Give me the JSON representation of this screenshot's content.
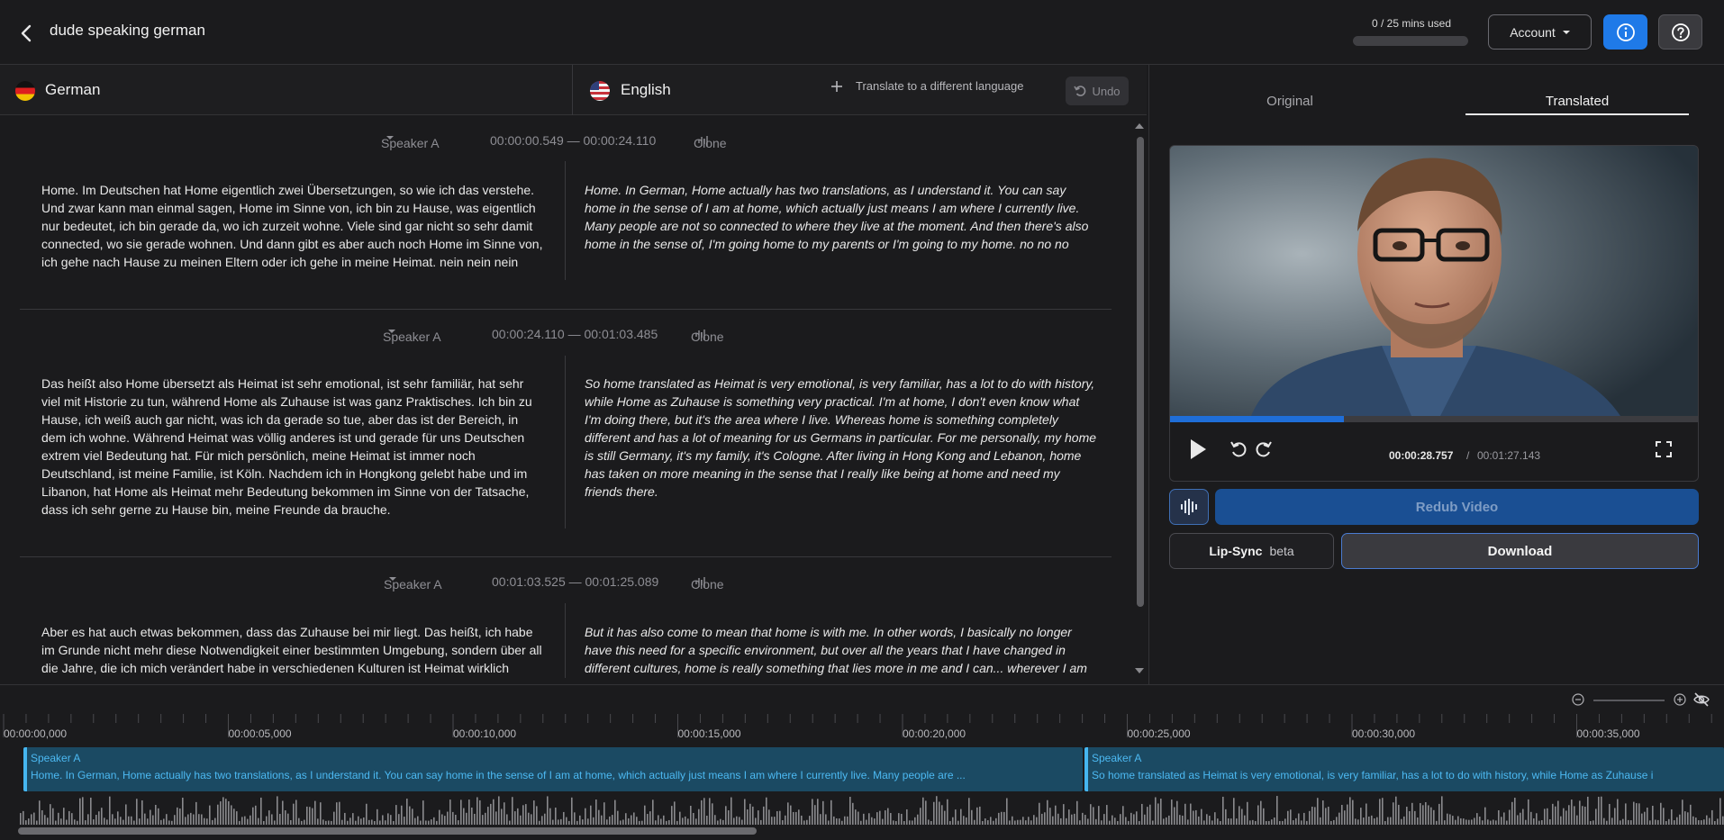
{
  "header": {
    "title": "dude speaking german",
    "usage_text": "0 / 25 mins used",
    "usage_fraction": 0,
    "account_label": "Account",
    "accent_color": "#1f7ae8"
  },
  "languages": {
    "source": "German",
    "target": "English",
    "translate_link": "Translate to a different language",
    "undo_label": "Undo"
  },
  "segments": [
    {
      "speaker": "Speaker A",
      "time_range": "00:00:00.549 — 00:00:24.110",
      "clone_label": "Clone",
      "original": "Home. Im Deutschen hat Home eigentlich zwei Übersetzungen, so wie ich das verstehe. Und zwar kann man einmal sagen, Home im Sinne von, ich bin zu Hause, was eigentlich nur bedeutet, ich bin gerade da, wo ich zurzeit wohne. Viele sind gar nicht so sehr damit connected, wo sie gerade wohnen. Und dann gibt es aber auch noch Home im Sinne von, ich gehe nach Hause zu meinen Eltern oder ich gehe in meine Heimat. nein nein nein",
      "translated": "Home. In German, Home actually has two translations, as I understand it. You can say home in the sense of I am at home, which actually just means I am where I currently live. Many people are not so connected to where they live at the moment. And then there's also home in the sense of, I'm going home to my parents or I'm going to my home. no no no"
    },
    {
      "speaker": "Speaker A",
      "time_range": "00:00:24.110 — 00:01:03.485",
      "clone_label": "Clone",
      "original": "Das heißt also Home übersetzt als Heimat ist sehr emotional, ist sehr familiär, hat sehr viel mit Historie zu tun, während Home als Zuhause ist was ganz Praktisches. Ich bin zu Hause, ich weiß auch gar nicht, was ich da gerade so tue, aber das ist der Bereich, in dem ich wohne. Während Heimat was völlig anderes ist und gerade für uns Deutschen extrem viel Bedeutung hat. Für mich persönlich, meine Heimat ist immer noch Deutschland, ist meine Familie, ist Köln. Nachdem ich in Hongkong gelebt habe und im Libanon, hat Home als Heimat mehr Bedeutung bekommen im Sinne von der Tatsache, dass ich sehr gerne zu Hause bin, meine Freunde da brauche.",
      "translated": "So home translated as Heimat is very emotional, is very familiar, has a lot to do with history, while Home as Zuhause is something very practical. I'm at home, I don't even know what I'm doing there, but it's the area where I live. Whereas home is something completely different and has a lot of meaning for us Germans in particular. For me personally, my home is still Germany, it's my family, it's Cologne. After living in Hong Kong and Lebanon, home has taken on more meaning in the sense that I really like being at home and need my friends there."
    },
    {
      "speaker": "Speaker A",
      "time_range": "00:01:03.525 — 00:01:25.089",
      "clone_label": "Clone",
      "original": "Aber es hat auch etwas bekommen, dass das Zuhause bei mir liegt. Das heißt, ich habe im Grunde nicht mehr diese Notwendigkeit einer bestimmten Umgebung, sondern über all die Jahre, die ich mich verändert habe in verschiedenen Kulturen ist Heimat wirklich etwas, was mehr in mir liegt und",
      "translated": "But it has also come to mean that home is with me. In other words, I basically no longer have this need for a specific environment, but over all the years that I have changed in different cultures, home is really something that lies more in me and I can... wherever I am at home and"
    }
  ],
  "tabs": {
    "original": "Original",
    "translated": "Translated",
    "active": "translated"
  },
  "player": {
    "current_time": "00:00:28.757",
    "separator": "/",
    "total_time": "00:01:27.143",
    "progress_fraction": 0.33
  },
  "actions": {
    "redub": "Redub Video",
    "lipsync": "Lip-Sync",
    "lipsync_badge": "beta",
    "download": "Download"
  },
  "timeline": {
    "ticks": [
      "00:00:00,000",
      "00:00:05,000",
      "00:00:10,000",
      "00:00:15,000",
      "00:00:20,000",
      "00:00:25,000",
      "00:00:30,000",
      "00:00:35,000"
    ],
    "clips": [
      {
        "speaker": "Speaker A",
        "text": "Home. In German, Home actually has two translations, as I understand it. You can say home in the sense of I am at home, which actually just means I am where I currently live. Many people are ..."
      },
      {
        "speaker": "Speaker A",
        "text": "So home translated as Heimat is very emotional, is very familiar, has a lot to do with history, while Home as Zuhause i"
      }
    ]
  }
}
